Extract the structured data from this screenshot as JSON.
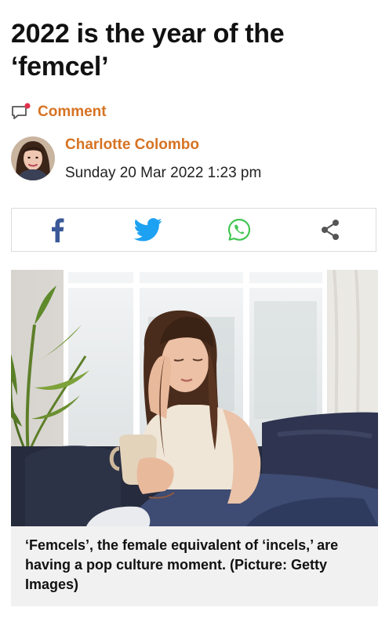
{
  "article": {
    "headline": "2022 is the year of the ‘femcel’",
    "comment_label": "Comment",
    "author": "Charlotte Colombo",
    "published": "Sunday 20 Mar 2022 1:23 pm"
  },
  "share": [
    {
      "icon": "facebook-icon",
      "color": "#3b5998"
    },
    {
      "icon": "twitter-icon",
      "color": "#1da1f2"
    },
    {
      "icon": "whatsapp-icon",
      "color": "#43c553"
    },
    {
      "icon": "share-icon",
      "color": "#555555"
    }
  ],
  "image": {
    "caption": "‘Femcels’, the female equivalent of ‘incels,’ are having a pop culture moment. (Picture: Getty Images)"
  },
  "colors": {
    "accent": "#d67323",
    "caption_bg": "#f1f1f1"
  }
}
